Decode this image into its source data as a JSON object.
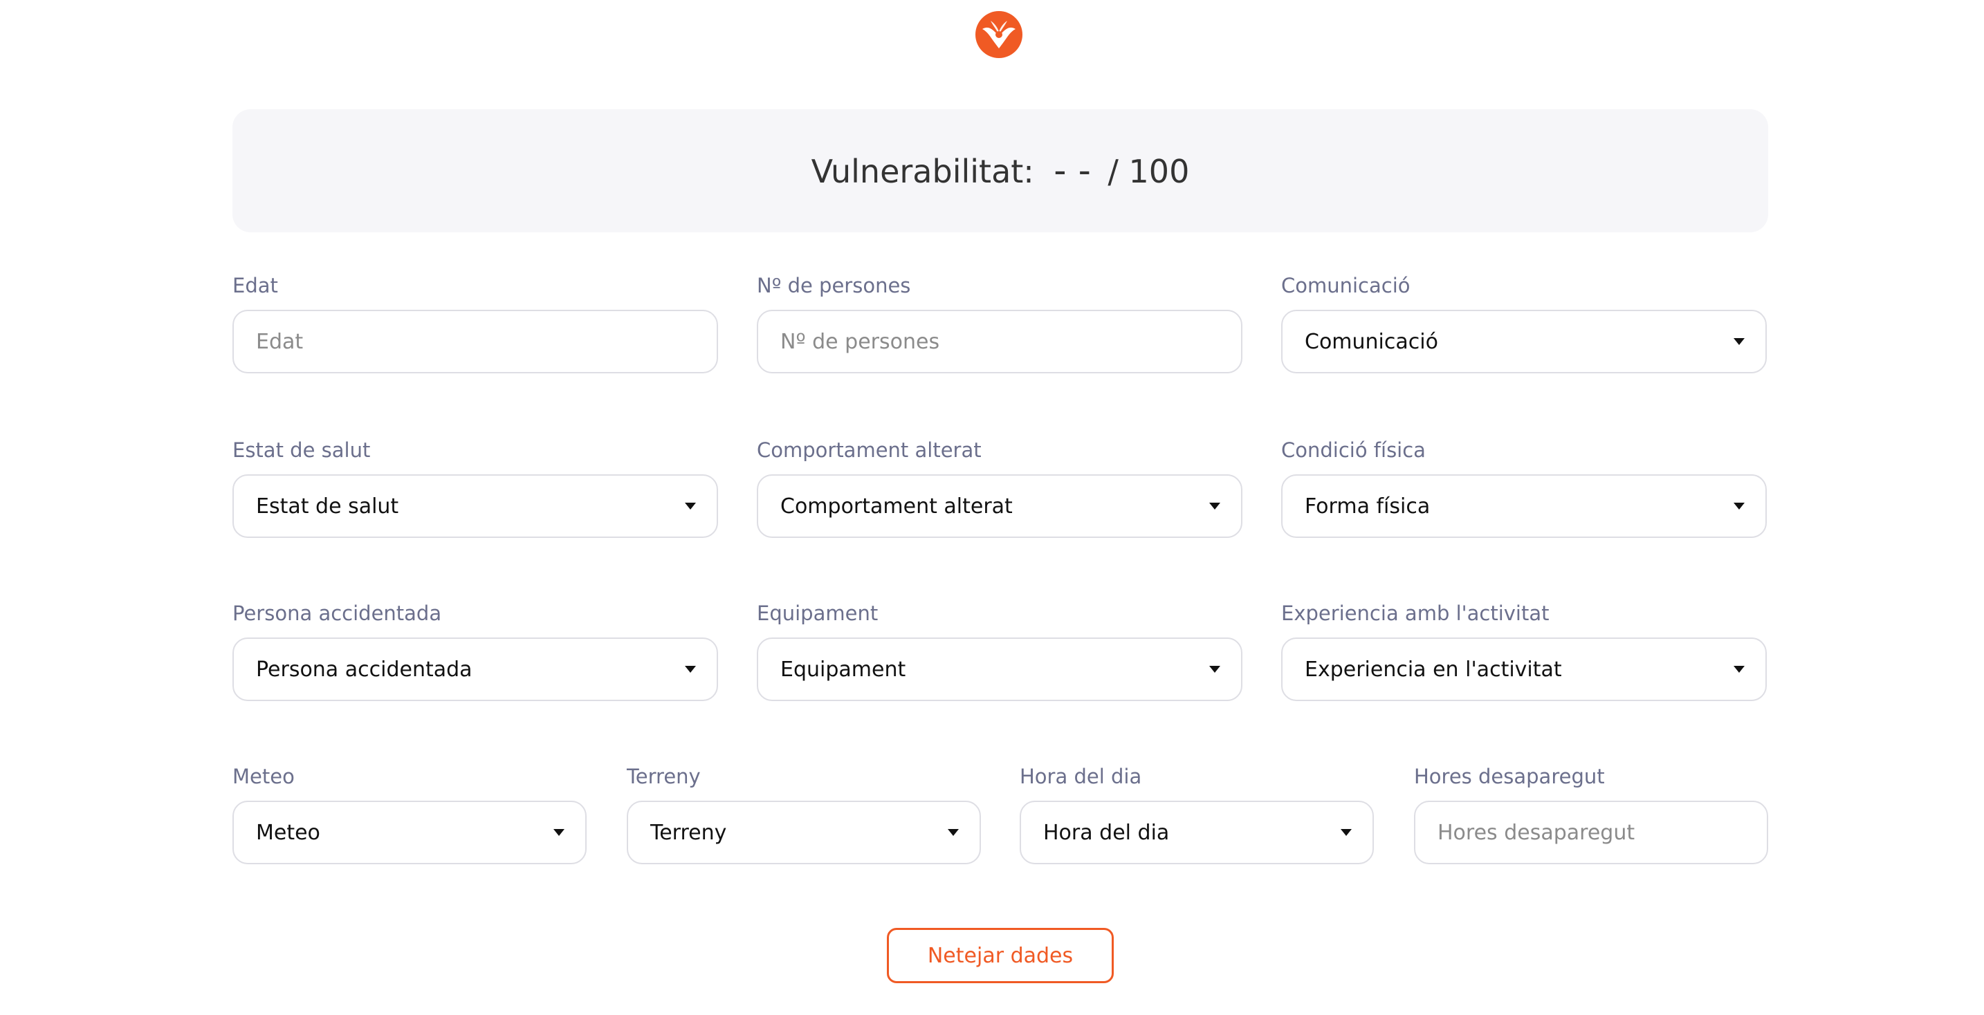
{
  "brand": {
    "accent_color": "#f05a24",
    "logo_icon": "bird-logo-icon"
  },
  "score": {
    "label": "Vulnerabilitat:",
    "value": "--",
    "max": "/ 100"
  },
  "fields": {
    "edat": {
      "label": "Edat",
      "placeholder": "Edat",
      "value": ""
    },
    "persones": {
      "label": "Nº de persones",
      "placeholder": "Nº de persones",
      "value": ""
    },
    "comunicacio": {
      "label": "Comunicació",
      "selected": "Comunicació"
    },
    "salut": {
      "label": "Estat de salut",
      "selected": "Estat de salut"
    },
    "comportament": {
      "label": "Comportament alterat",
      "selected": "Comportament alterat"
    },
    "condicio": {
      "label": "Condició física",
      "selected": "Forma física"
    },
    "accidentada": {
      "label": "Persona accidentada",
      "selected": "Persona accidentada"
    },
    "equipament": {
      "label": "Equipament",
      "selected": "Equipament"
    },
    "experiencia": {
      "label": "Experiencia amb l'activitat",
      "selected": "Experiencia en l'activitat"
    },
    "meteo": {
      "label": "Meteo",
      "selected": "Meteo"
    },
    "terreny": {
      "label": "Terreny",
      "selected": "Terreny"
    },
    "hora": {
      "label": "Hora del dia",
      "selected": "Hora del dia"
    },
    "hores": {
      "label": "Hores desaparegut",
      "placeholder": "Hores desaparegut",
      "value": ""
    }
  },
  "actions": {
    "clear_label": "Netejar dades"
  }
}
